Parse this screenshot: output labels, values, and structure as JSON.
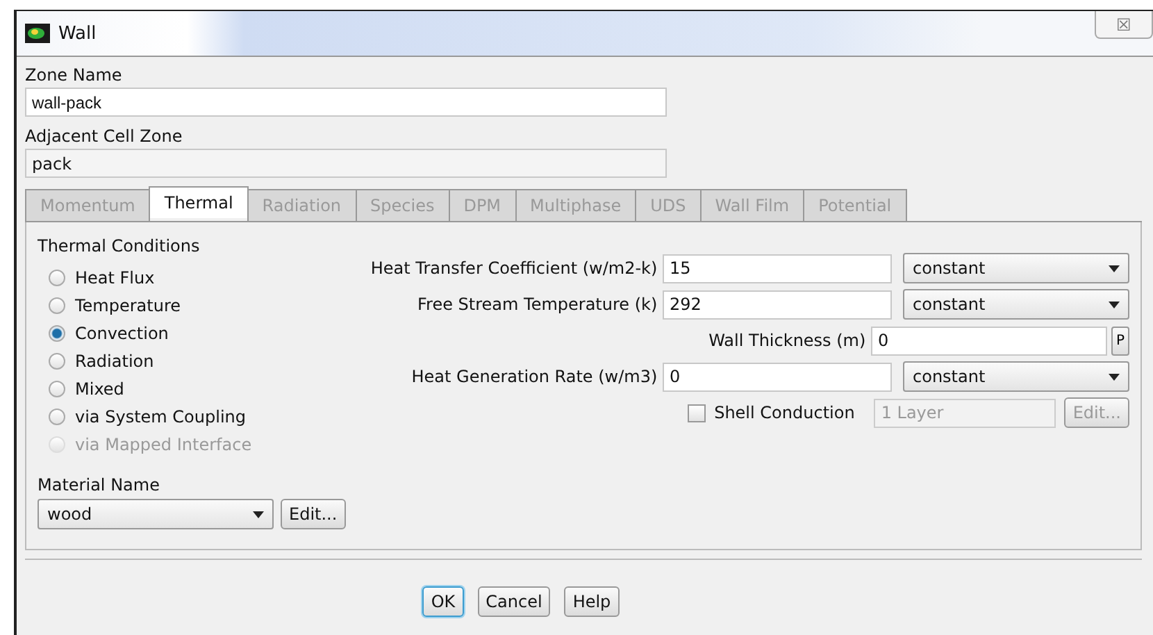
{
  "window": {
    "title": "Wall",
    "close": "☒"
  },
  "zone_name": {
    "label": "Zone Name",
    "value": "wall-pack"
  },
  "adjacent_cell_zone": {
    "label": "Adjacent Cell Zone",
    "value": "pack"
  },
  "tabs": [
    {
      "label": "Momentum",
      "selected": false
    },
    {
      "label": "Thermal",
      "selected": true
    },
    {
      "label": "Radiation",
      "selected": false
    },
    {
      "label": "Species",
      "selected": false
    },
    {
      "label": "DPM",
      "selected": false
    },
    {
      "label": "Multiphase",
      "selected": false
    },
    {
      "label": "UDS",
      "selected": false
    },
    {
      "label": "Wall Film",
      "selected": false
    },
    {
      "label": "Potential",
      "selected": false
    }
  ],
  "thermal_conditions": {
    "title": "Thermal Conditions",
    "options": [
      {
        "label": "Heat Flux",
        "selected": false,
        "disabled": false
      },
      {
        "label": "Temperature",
        "selected": false,
        "disabled": false
      },
      {
        "label": "Convection",
        "selected": true,
        "disabled": false
      },
      {
        "label": "Radiation",
        "selected": false,
        "disabled": false
      },
      {
        "label": "Mixed",
        "selected": false,
        "disabled": false
      },
      {
        "label": "via System Coupling",
        "selected": false,
        "disabled": false
      },
      {
        "label": "via Mapped Interface",
        "selected": false,
        "disabled": true
      }
    ]
  },
  "parameters": [
    {
      "kind": "profile",
      "label": "Heat Transfer Coefficient (w/m2-k)",
      "value": "15",
      "method": "constant"
    },
    {
      "kind": "profile",
      "label": "Free Stream Temperature (k)",
      "value": "292",
      "method": "constant"
    },
    {
      "kind": "param",
      "label": "Wall Thickness (m)",
      "value": "0",
      "button": "P"
    },
    {
      "kind": "profile",
      "label": "Heat Generation Rate (w/m3)",
      "value": "0",
      "method": "constant"
    },
    {
      "kind": "shell",
      "label": "Shell Conduction",
      "checked": false,
      "value": "1 Layer",
      "button": "Edit...",
      "disabled": true
    }
  ],
  "material": {
    "label": "Material Name",
    "value": "wood",
    "button": "Edit..."
  },
  "buttons": [
    {
      "label": "OK",
      "default": true
    },
    {
      "label": "Cancel",
      "default": false
    },
    {
      "label": "Help",
      "default": false
    }
  ]
}
